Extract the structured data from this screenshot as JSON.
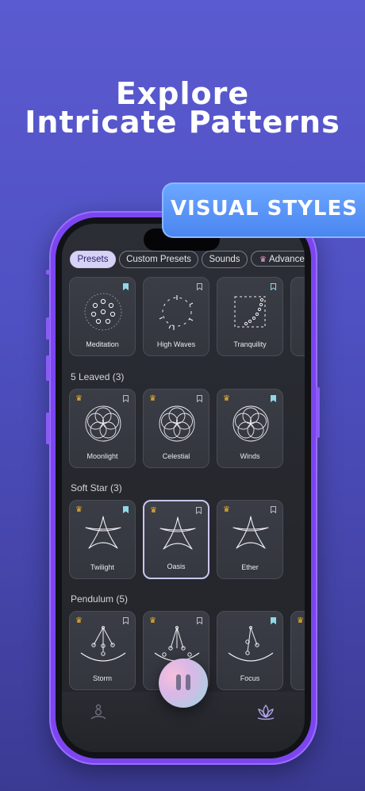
{
  "headline": {
    "line1": "Explore",
    "line2": "Intricate Patterns"
  },
  "badge": {
    "label": "VISUAL STYLES"
  },
  "tabs": [
    {
      "label": "Presets",
      "active": true
    },
    {
      "label": "Custom Presets",
      "active": false
    },
    {
      "label": "Sounds",
      "active": false
    },
    {
      "label": "Advance",
      "active": false,
      "icon": "crown-icon"
    }
  ],
  "sections": [
    {
      "title": "",
      "cards": [
        {
          "label": "Meditation",
          "premium": false,
          "saved": true
        },
        {
          "label": "High Waves",
          "premium": false,
          "saved": false
        },
        {
          "label": "Tranquility",
          "premium": false,
          "saved": true
        }
      ]
    },
    {
      "title": "5 Leaved (3)",
      "cards": [
        {
          "label": "Moonlight",
          "premium": true,
          "saved": false
        },
        {
          "label": "Celestial",
          "premium": true,
          "saved": false
        },
        {
          "label": "Winds",
          "premium": true,
          "saved": true
        }
      ]
    },
    {
      "title": "Soft Star (3)",
      "cards": [
        {
          "label": "Twilight",
          "premium": true,
          "saved": true
        },
        {
          "label": "Oasis",
          "premium": true,
          "saved": false,
          "selected": true
        },
        {
          "label": "Ether",
          "premium": true,
          "saved": false
        }
      ]
    },
    {
      "title": "Pendulum (5)",
      "cards": [
        {
          "label": "Storm",
          "premium": true,
          "saved": false
        },
        {
          "label": "",
          "premium": true,
          "saved": false
        },
        {
          "label": "Focus",
          "premium": false,
          "saved": true
        }
      ]
    }
  ],
  "colors": {
    "accent": "#7b46f0",
    "badge": "#5a95f7",
    "bookmark": "#8fd6e8",
    "crown": "#f2b52d"
  }
}
